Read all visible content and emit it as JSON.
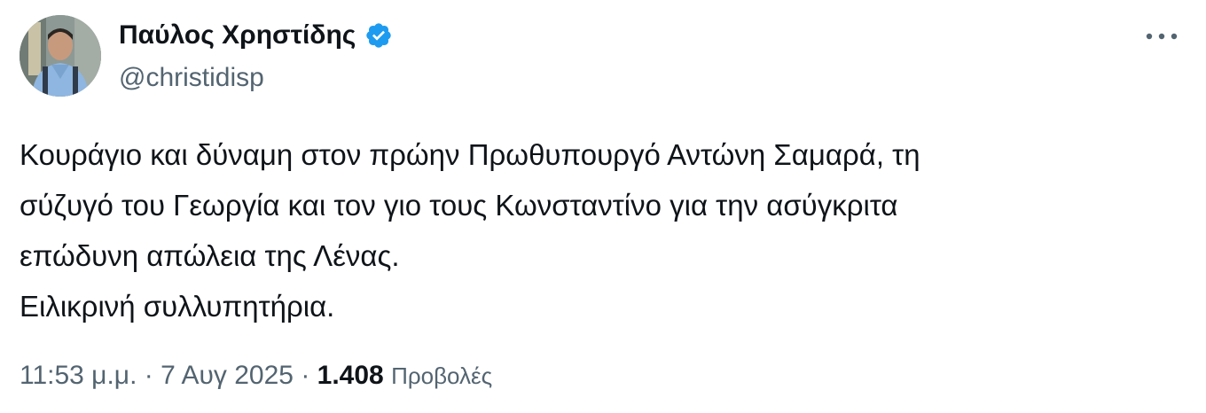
{
  "author": {
    "name": "Παύλος Χρηστίδης",
    "handle": "@christidisp",
    "verified": true,
    "verified_color": "#1d9bf0",
    "avatar_icon": "profile-photo"
  },
  "more_icon": "more-horizontal-icon",
  "tweet": {
    "lines": [
      "Κουράγιο και δύναμη στον πρώην Πρωθυπουργό Αντώνη Σαμαρά, τη",
      "σύζυγό του Γεωργία και τον γιο τους Κωνσταντίνο για την ασύγκριτα",
      "επώδυνη απώλεια της Λένας.",
      "Ειλικρινή συλλυπητήρια."
    ]
  },
  "meta": {
    "time": "11:53 μ.μ.",
    "separator": "·",
    "date": "7 Αυγ 2025",
    "views_count": "1.408",
    "views_label": "Προβολές"
  },
  "colors": {
    "text": "#0f1419",
    "secondary": "#536471",
    "background": "#ffffff"
  }
}
